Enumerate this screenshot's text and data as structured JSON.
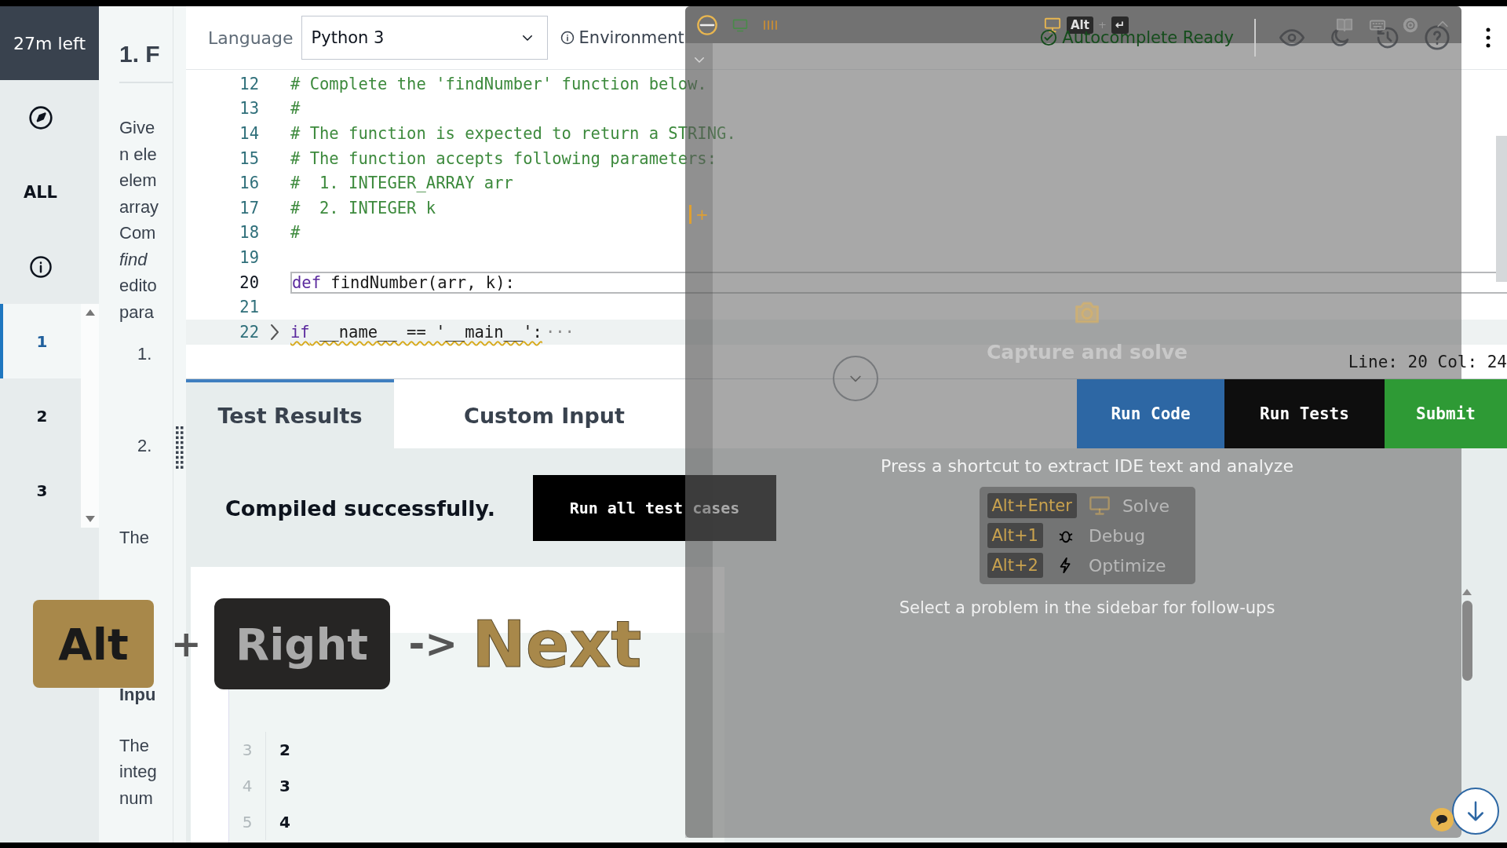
{
  "timer": "27m left",
  "nav": {
    "all_label": "ALL",
    "questions": [
      {
        "number": "1",
        "selected": true
      },
      {
        "number": "2",
        "selected": false
      },
      {
        "number": "3",
        "selected": false
      }
    ]
  },
  "problem": {
    "title": "1. F",
    "lines": [
      {
        "text": "Give",
        "kind": "text"
      },
      {
        "text": "n ele",
        "kind": "text"
      },
      {
        "text": "elem",
        "kind": "text"
      },
      {
        "text": "array",
        "kind": "text"
      },
      {
        "text": "Com",
        "kind": "text"
      },
      {
        "text": "find",
        "kind": "italic"
      },
      {
        "text": "edito",
        "kind": "text"
      },
      {
        "text": "para",
        "kind": "text"
      },
      {
        "text": "1.",
        "kind": "list"
      },
      {
        "text": "2.",
        "kind": "list"
      },
      {
        "text": "The",
        "kind": "para"
      },
      {
        "text": "Inpu",
        "kind": "heading"
      },
      {
        "text": "The",
        "kind": "para"
      },
      {
        "text": "integ",
        "kind": "text"
      },
      {
        "text": "num",
        "kind": "text"
      }
    ]
  },
  "editor": {
    "language_label": "Language",
    "language": "Python 3",
    "environment": "Environment",
    "status": "Autocomplete Ready",
    "cursor": "Line: 20 Col: 24",
    "fold_text": "···",
    "lines": [
      {
        "number": "12",
        "kind": "comment",
        "current": false,
        "folded": false,
        "warning": false,
        "code": "# Complete the 'findNumber' function below."
      },
      {
        "number": "13",
        "kind": "comment",
        "current": false,
        "folded": false,
        "warning": false,
        "code": "#"
      },
      {
        "number": "14",
        "kind": "comment",
        "current": false,
        "folded": false,
        "warning": false,
        "code": "# The function is expected to return a STRING."
      },
      {
        "number": "15",
        "kind": "comment",
        "current": false,
        "folded": false,
        "warning": false,
        "code": "# The function accepts following parameters:"
      },
      {
        "number": "16",
        "kind": "comment",
        "current": false,
        "folded": false,
        "warning": false,
        "code": "#  1. INTEGER_ARRAY arr"
      },
      {
        "number": "17",
        "kind": "comment",
        "current": false,
        "folded": false,
        "warning": false,
        "code": "#  2. INTEGER k"
      },
      {
        "number": "18",
        "kind": "comment",
        "current": false,
        "folded": false,
        "warning": false,
        "code": "#"
      },
      {
        "number": "19",
        "kind": "blank",
        "current": false,
        "folded": false
      },
      {
        "number": "20",
        "kind": "code",
        "current": true,
        "folded": false,
        "warning": false,
        "code": "def findNumber(arr, k):"
      },
      {
        "number": "21",
        "kind": "blank",
        "current": false,
        "folded": false
      },
      {
        "number": "22",
        "kind": "code",
        "current": false,
        "folded": true,
        "warning": true,
        "code": "if __name__ == '__main__':"
      }
    ]
  },
  "panel": {
    "tabs": [
      {
        "label": "Test Results",
        "selected": true
      },
      {
        "label": "Custom Input",
        "selected": false
      }
    ],
    "buttons": [
      {
        "label": "Run Code",
        "kind": "primary"
      },
      {
        "label": "Run Tests",
        "kind": "dark"
      },
      {
        "label": "Submit",
        "kind": "success"
      }
    ],
    "message": "Compiled successfully.",
    "run_all": "Run all test cases",
    "output_lines": [
      {
        "number": "3",
        "value": "2"
      },
      {
        "number": "4",
        "value": "3"
      },
      {
        "number": "5",
        "value": "4"
      }
    ]
  },
  "keystroke": {
    "modifier": "Alt",
    "plus": "+",
    "key": "Right",
    "arrow": "->",
    "action": "Next"
  },
  "assistant": {
    "hotkey": {
      "modifier": "Alt",
      "plus": "+",
      "key": "↵"
    },
    "add_label": "+",
    "title": "Capture and solve",
    "hint": "Press a shortcut to extract IDE text and analyze",
    "shortcuts": [
      {
        "keys": "Alt+Enter",
        "label": "Solve",
        "kind": "solve"
      },
      {
        "keys": "Alt+1",
        "label": "Debug",
        "kind": "debug"
      },
      {
        "keys": "Alt+2",
        "label": "Optimize",
        "kind": "optimize"
      }
    ],
    "footer": "Select a problem in the sidebar for follow-ups"
  }
}
